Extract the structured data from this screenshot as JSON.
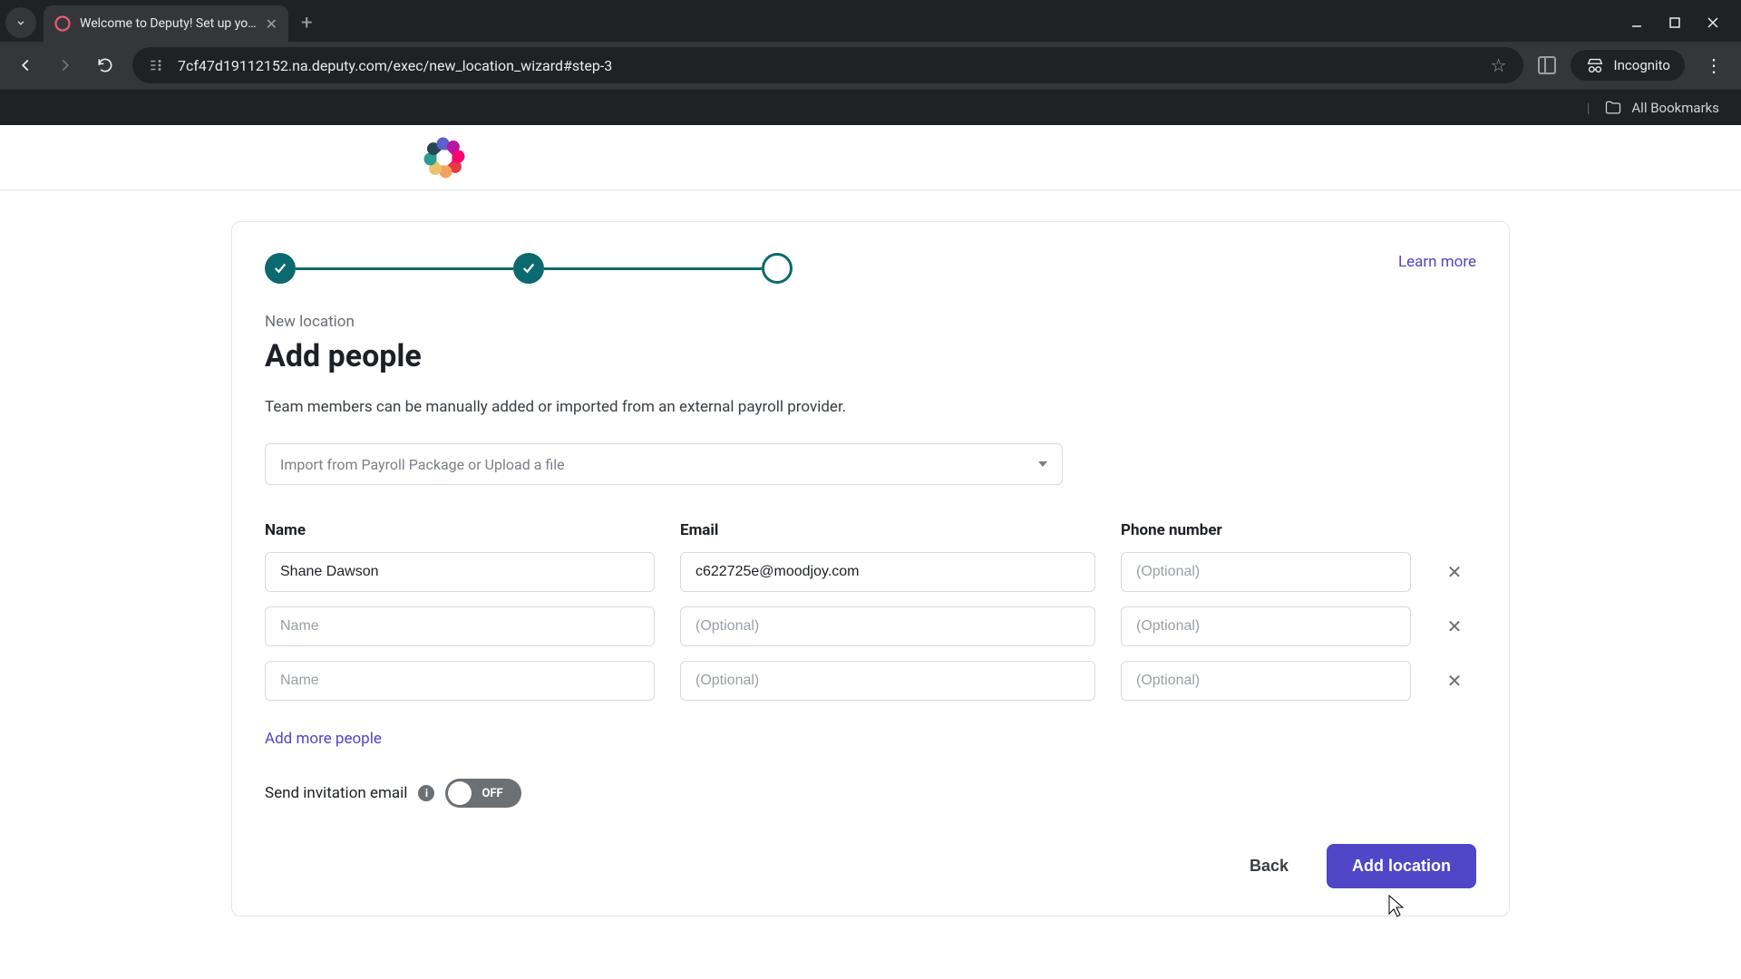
{
  "browser": {
    "tab_title": "Welcome to Deputy! Set up yo…",
    "url": "7cf47d19112152.na.deputy.com/exec/new_location_wizard#step-3",
    "incognito_label": "Incognito",
    "all_bookmarks": "All Bookmarks"
  },
  "learn_more": "Learn more",
  "breadcrumb": "New location",
  "title": "Add people",
  "description": "Team members can be manually added or imported from an external payroll provider.",
  "import_dropdown": "Import from Payroll Package or Upload a file",
  "columns": {
    "name": "Name",
    "email": "Email",
    "phone": "Phone number"
  },
  "rows": [
    {
      "name": "Shane Dawson",
      "email": "c622725e@moodjoy.com",
      "phone": "",
      "name_ph": "Name",
      "email_ph": "(Optional)",
      "phone_ph": "(Optional)"
    },
    {
      "name": "",
      "email": "",
      "phone": "",
      "name_ph": "Name",
      "email_ph": "(Optional)",
      "phone_ph": "(Optional)"
    },
    {
      "name": "",
      "email": "",
      "phone": "",
      "name_ph": "Name",
      "email_ph": "(Optional)",
      "phone_ph": "(Optional)"
    }
  ],
  "add_more": "Add more people",
  "toggle": {
    "label": "Send invitation email",
    "state": "OFF"
  },
  "buttons": {
    "back": "Back",
    "submit": "Add location"
  }
}
